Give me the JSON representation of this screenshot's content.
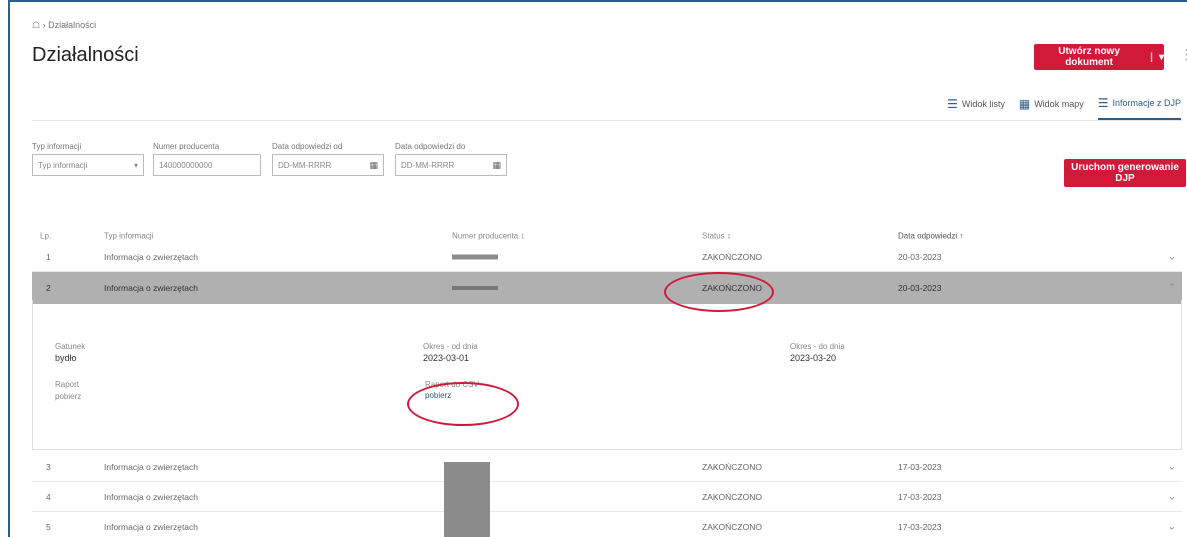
{
  "breadcrumb": "☖ › Działalności",
  "page_title": "Działalności",
  "header": {
    "new_doc_label": "Utwórz nowy dokument",
    "new_doc_sep": "|",
    "new_doc_arrow": "▾",
    "kebab": "⋮"
  },
  "view_tabs": [
    {
      "label": "Widok listy",
      "icon": "list-icon"
    },
    {
      "label": "Widok mapy",
      "icon": "map-icon"
    },
    {
      "label": "Informacje z DJP",
      "icon": "info-list-icon",
      "active": true
    }
  ],
  "filters": {
    "type": {
      "label": "Typ informacji",
      "placeholder": "Typ informacji",
      "arrow": "▾"
    },
    "producer": {
      "label": "Numer producenta",
      "value": "140000000000"
    },
    "date_from": {
      "label": "Data odpowiedzi od",
      "placeholder": "DD-MM-RRRR"
    },
    "date_to": {
      "label": "Data odpowiedzi do",
      "placeholder": "DD-MM-RRRR"
    }
  },
  "generate_button": "Uruchom generowanie DJP",
  "table": {
    "headers": {
      "lp": "Lp.",
      "type": "Typ informacji",
      "producer": "Numer producenta ↕",
      "status": "Status ↕",
      "date": "Data odpowiedzi ↑"
    },
    "rows": [
      {
        "lp": "1",
        "type": "Informacja o zwierzętach",
        "status": "ZAKOŃCZONO",
        "date": "20-03-2023",
        "chevron": "⌄"
      },
      {
        "lp": "2",
        "type": "Informacja o zwierzętach",
        "status": "ZAKOŃCZONO",
        "date": "20-03-2023",
        "chevron": "⌃"
      },
      {
        "lp": "3",
        "type": "Informacja o zwierzętach",
        "status": "ZAKOŃCZONO",
        "date": "17-03-2023",
        "chevron": "⌄"
      },
      {
        "lp": "4",
        "type": "Informacja o zwierzętach",
        "status": "ZAKOŃCZONO",
        "date": "17-03-2023",
        "chevron": "⌄"
      },
      {
        "lp": "5",
        "type": "Informacja o zwierzętach",
        "status": "ZAKOŃCZONO",
        "date": "17-03-2023",
        "chevron": "⌄"
      }
    ]
  },
  "detail": {
    "species_label": "Gatunek",
    "species_value": "bydło",
    "from_label": "Okres - od dnia",
    "from_value": "2023-03-01",
    "to_label": "Okres - do dnia",
    "to_value": "2023-03-20",
    "report_label": "Raport",
    "report_link": "pobierz",
    "csv_label": "Raport do CSV",
    "csv_link": "pobierz"
  },
  "colors": {
    "accent": "#d11a3a",
    "link": "#2f5d8a",
    "selected_row": "#b0b0b0"
  }
}
